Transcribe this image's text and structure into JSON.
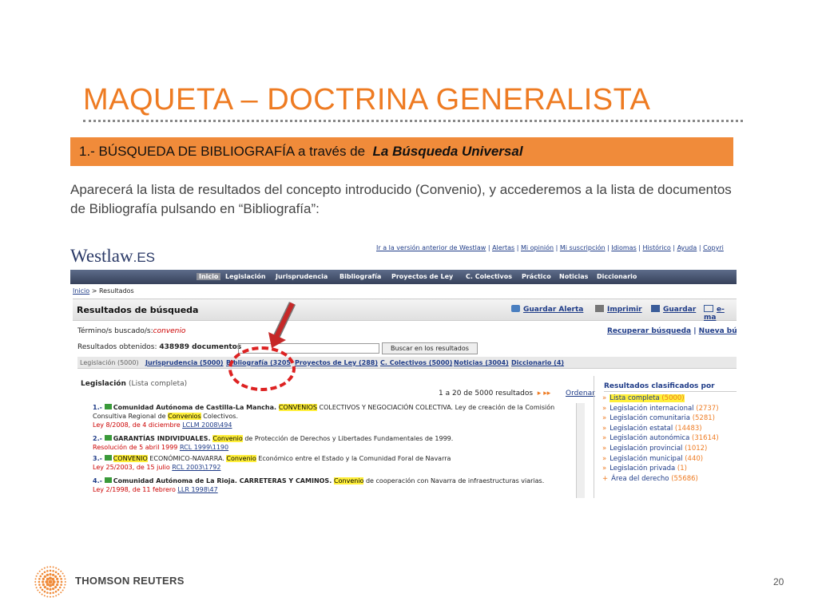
{
  "slide": {
    "title": "MAQUETA – DOCTRINA GENERALISTA",
    "section_prefix": "1.-  BÚSQUEDA DE BIBLIOGRAFÍA a través de",
    "section_emph": "La Búsqueda Universal",
    "intro": "Aparecerá la lista de resultados del concepto introducido (Convenio), y accederemos a la lista de documentos de Bibliografía pulsando en “Bibliografía”:",
    "page_number": "20",
    "footer_brand": "THOMSON REUTERS"
  },
  "westlaw": {
    "logo_main": "Westlaw",
    "logo_suffix": ".ES",
    "top_links": [
      "Ir a la versión anterior de Westlaw",
      "Alertas",
      "Mi opinión",
      "Mi suscripción",
      "Idiomas",
      "Histórico",
      "Ayuda",
      "Copyri"
    ],
    "nav": [
      "Inicio",
      "Legislación",
      "Jurisprudencia",
      "Bibliografía",
      "Proyectos de Ley",
      "C. Colectivos",
      "Práctico",
      "Noticias",
      "Diccionario"
    ],
    "breadcrumb_link": "Inicio",
    "breadcrumb_rest": " > Resultados",
    "header_title": "Resultados de búsqueda",
    "actions": [
      "Guardar Alerta",
      "Imprimir",
      "Guardar",
      "e-ma"
    ],
    "term_label": "Término/s buscado/s:",
    "term_value": "convenio",
    "results_label": "Resultados obtenidos:",
    "results_value": "438989 documentos",
    "search_button": "Buscar en los resultados",
    "recover_link": "Recuperar búsqueda",
    "new_link": "Nueva búsq",
    "tabs": [
      "Legislación (5000)",
      "Jurisprudencia (5000)",
      "Bibliografía (3205",
      "Proyectos de Ley (288)",
      "C. Colectivos (5000)",
      "Noticias (3004)",
      "Diccionario (4)"
    ],
    "list_title": "Legislación",
    "list_subtitle": "(Lista completa)",
    "range_text": "1 a 20 de 5000 resultados",
    "order_link": "Ordenar",
    "results": [
      {
        "num": "1.-",
        "pre": "Comunidad Autónoma de Castilla-La Mancha. ",
        "hl": "CONVENIOS",
        "post": " COLECTIVOS Y NEGOCIACIÓN COLECTIVA. Ley de creación de la Comisión",
        "line2_pre": "Consultiva Regional de ",
        "line2_hl": "Convenios",
        "line2_post": " Colectivos.",
        "cite": "Ley 8/2008, de 4 diciembre ",
        "ref": "LCLM 2008\\494"
      },
      {
        "num": "2.-",
        "pre": "GARANTÍAS INDIVIDUALES. ",
        "hl": "Convenio",
        "post": " de Protección de Derechos y Libertades Fundamentales de 1999.",
        "cite": "Resolución de 5 abril 1999 ",
        "ref": "RCL 1999\\1190"
      },
      {
        "num": "3.-",
        "pre": "",
        "hl": "CONVENIO",
        "post": " ECONÓMICO-NAVARRA. ",
        "hl2": "Convenio",
        "post2": " Económico entre el Estado y la Comunidad Foral de Navarra",
        "cite": "Ley 25/2003, de 15 julio ",
        "ref": "RCL 2003\\1792"
      },
      {
        "num": "4.-",
        "pre": "Comunidad Autónoma de La Rioja. CARRETERAS Y CAMINOS. ",
        "hl": "Convenio",
        "post": " de cooperación con Navarra de infraestructuras viarias.",
        "cite": "Ley 2/1998, de 11 febrero ",
        "ref": "LLR 1998\\47"
      }
    ],
    "side_title": "Resultados clasificados por",
    "side_items": [
      {
        "marker": "»",
        "label": "Lista completa",
        "count": "(5000)"
      },
      {
        "marker": "»",
        "label": "Legislación internacional",
        "count": "(2737)"
      },
      {
        "marker": "»",
        "label": "Legislación comunitaria",
        "count": "(5281)"
      },
      {
        "marker": "»",
        "label": "Legislación estatal",
        "count": "(14483)"
      },
      {
        "marker": "»",
        "label": "Legislación autonómica",
        "count": "(31614)"
      },
      {
        "marker": "»",
        "label": "Legislación provincial",
        "count": "(1012)"
      },
      {
        "marker": "»",
        "label": "Legislación municipal",
        "count": "(440)"
      },
      {
        "marker": "»",
        "label": "Legislación privada",
        "count": "(1)"
      },
      {
        "marker": "+",
        "label": "Área del derecho",
        "count": "(55686)"
      }
    ]
  }
}
